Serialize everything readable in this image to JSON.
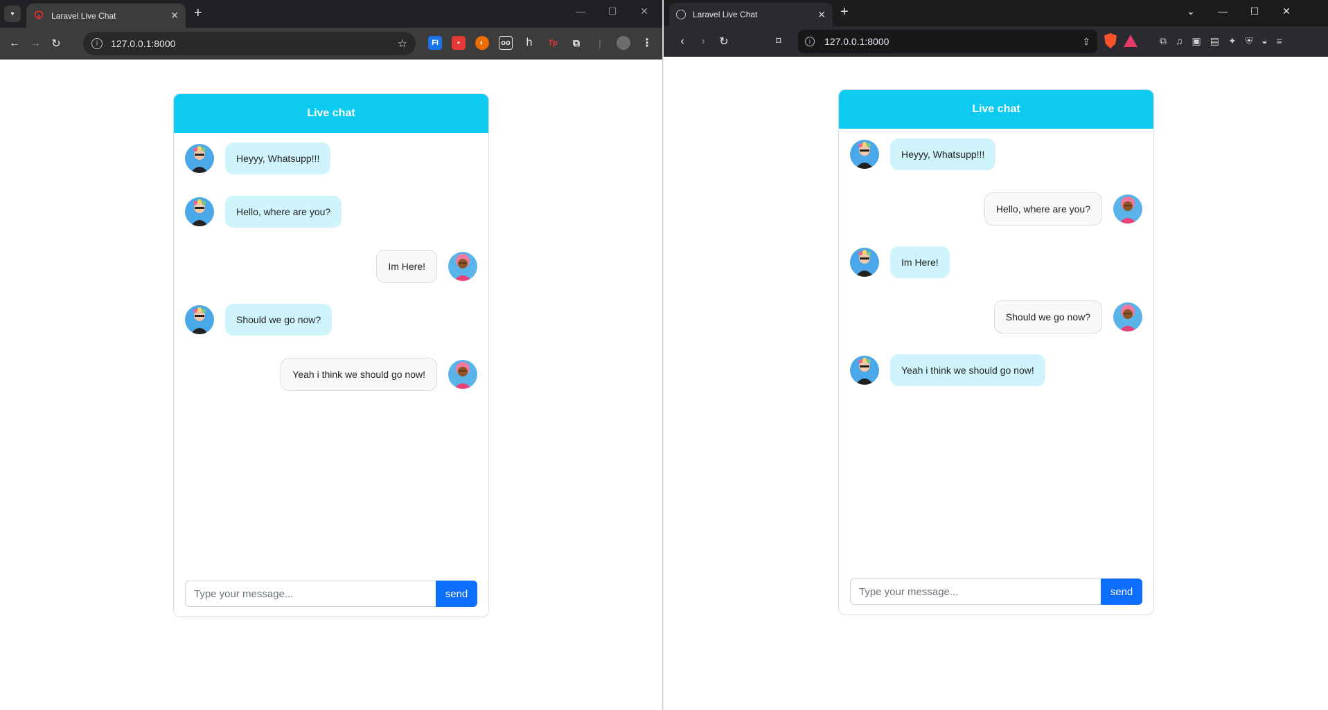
{
  "left_browser": {
    "tab_title": "Laravel Live Chat",
    "url": "127.0.0.1:8000",
    "extensions": [
      "FI",
      "h",
      "Tp"
    ]
  },
  "right_browser": {
    "tab_title": "Laravel Live Chat",
    "url": "127.0.0.1:8000"
  },
  "left_chat": {
    "header": "Live chat",
    "messages": [
      {
        "text": "Heyyy, Whatsupp!!!",
        "side": "in"
      },
      {
        "text": "Hello, where are you?",
        "side": "in"
      },
      {
        "text": "Im Here!",
        "side": "out"
      },
      {
        "text": "Should we go now?",
        "side": "in"
      },
      {
        "text": "Yeah i think we should go now!",
        "side": "out"
      }
    ],
    "input_placeholder": "Type your message...",
    "send_label": "send"
  },
  "right_chat": {
    "header": "Live chat",
    "messages": [
      {
        "text": "Heyyy, Whatsupp!!!",
        "side": "in"
      },
      {
        "text": "Hello, where are you?",
        "side": "out"
      },
      {
        "text": "Im Here!",
        "side": "in"
      },
      {
        "text": "Should we go now?",
        "side": "out"
      },
      {
        "text": "Yeah i think we should go now!",
        "side": "in"
      }
    ],
    "input_placeholder": "Type your message...",
    "send_label": "send"
  },
  "colors": {
    "header_bg": "#0dcaf0",
    "bubble_in": "#cff4fc",
    "bubble_out": "#f8f9fa",
    "send_button": "#0d6efd"
  }
}
